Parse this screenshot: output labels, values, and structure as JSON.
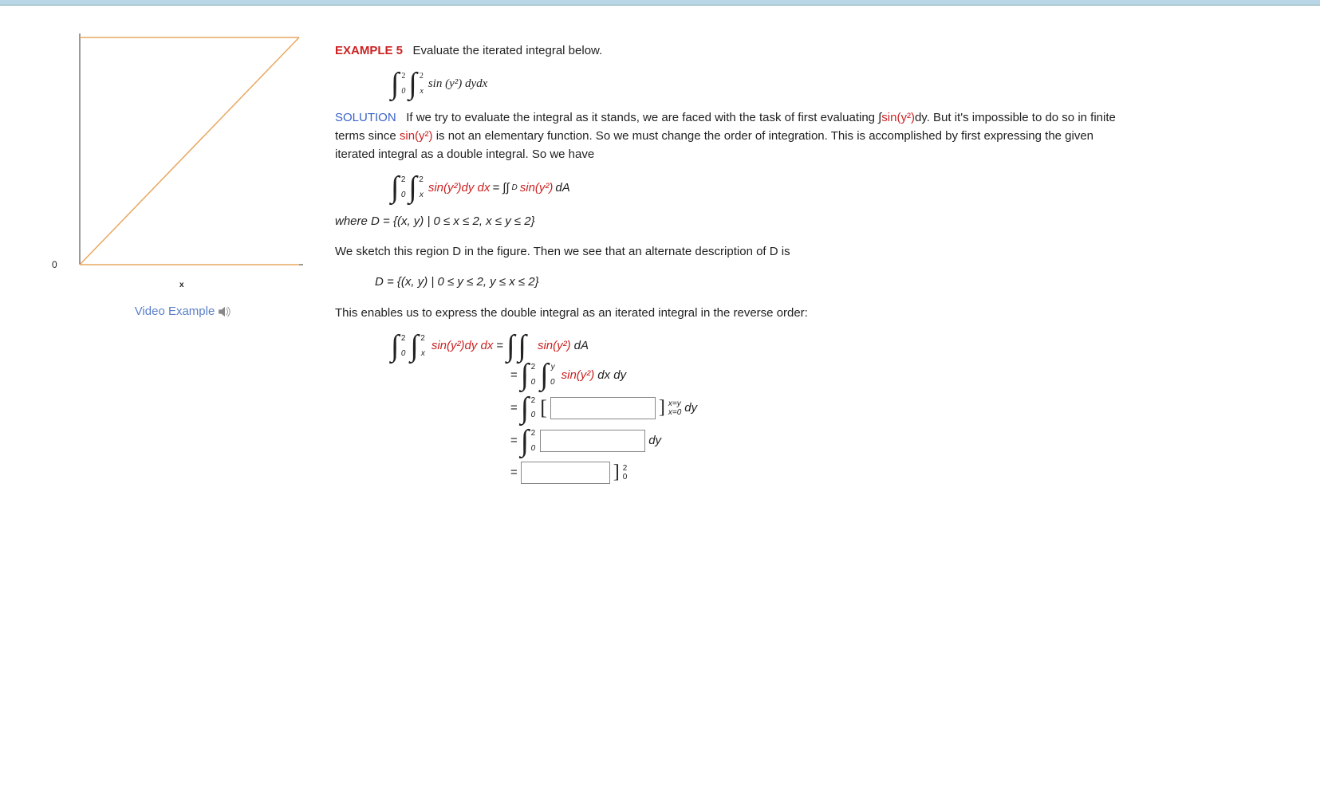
{
  "example": {
    "label": "EXAMPLE 5",
    "prompt": "Evaluate the iterated integral below."
  },
  "integral1": {
    "outer_lower": "0",
    "outer_upper": "2",
    "inner_lower": "x",
    "inner_upper": "2",
    "integrand": "sin (y²) dydx"
  },
  "solution_label": "SOLUTION",
  "solution_text1a": "If we try to evaluate the integral as it stands, we are faced with the task of first evaluating ∫",
  "solution_text1b": "dy. But it's impossible to do so in finite terms since ",
  "solution_sin1": "sin(y²)",
  "solution_sin2": "sin(y²)",
  "solution_text1c": " is not an elementary function. So we must change the order of integration. This is accomplished by first expressing the given iterated integral as a double integral. So we have",
  "eq2_lhs": "sin(y²)dy dx",
  "eq2_rhs_pre": " = ∫∫",
  "eq2_rhs_sub": "D ",
  "eq2_rhs_red": "sin(y²)",
  "eq2_rhs_post": "dA",
  "where_text": "where D = {(x, y) | 0 ≤ x ≤ 2, x ≤ y ≤ 2}",
  "sketch_text": "We sketch this region D in the figure. Then we see that an alternate description of D is",
  "alt_D": "D = {(x, y) | 0 ≤ y ≤ 2, y ≤ x ≤ 2}",
  "reverse_text": "This enables us to express the double integral as an iterated integral in the reverse order:",
  "chain": {
    "line1_lhs_integrand": "sin(y²)dy dx",
    "line1_eq": " = ",
    "line1_rhs_red": "sin(y²)",
    "line1_rhs_post": "dA",
    "line2_eq": "= ",
    "line2_inner_upper": "y",
    "line2_integrand_red": "sin(y²)",
    "line2_integrand_post": "dx dy",
    "line3_eq": "= ",
    "line3_eval_upper": "x=y",
    "line3_eval_lower": "x=0",
    "line3_post": " dy",
    "line4_eq": "= ",
    "line4_post": "dy",
    "line5_eq": "= ",
    "line5_eval_upper": "2",
    "line5_eval_lower": "0"
  },
  "figure": {
    "zero_label": "0",
    "x_label": "x"
  },
  "video_link": "Video Example"
}
